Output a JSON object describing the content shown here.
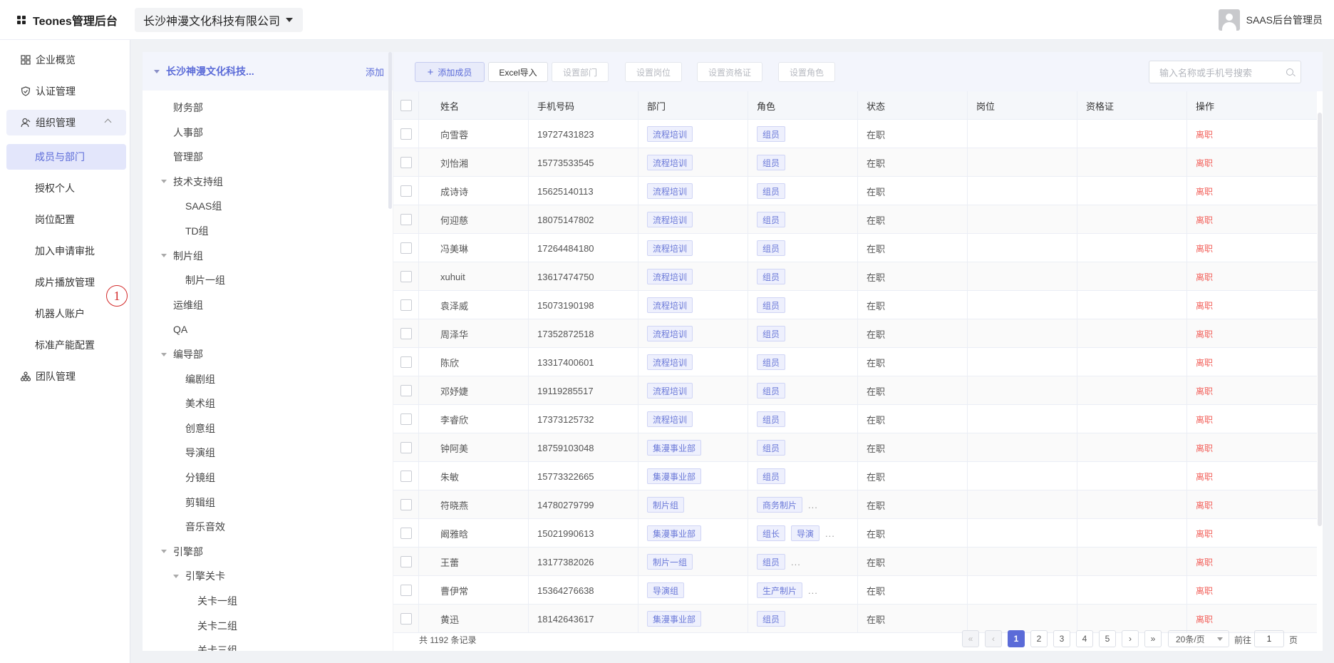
{
  "header": {
    "brand": "Teones管理后台",
    "company": "长沙神漫文化科技有限公司",
    "user": "SAAS后台管理员"
  },
  "sidebar": {
    "items": [
      {
        "label": "企业概览",
        "icon": "grid-icon"
      },
      {
        "label": "认证管理",
        "icon": "shield-icon"
      },
      {
        "label": "组织管理",
        "icon": "user-icon"
      },
      {
        "label": "成员与部门"
      },
      {
        "label": "授权个人"
      },
      {
        "label": "岗位配置"
      },
      {
        "label": "加入申请审批"
      },
      {
        "label": "成片播放管理"
      },
      {
        "label": "机器人账户"
      },
      {
        "label": "标准产能配置"
      },
      {
        "label": "团队管理",
        "icon": "org-chart-icon"
      }
    ],
    "annotation": "1"
  },
  "tree": {
    "root": "长沙神漫文化科技...",
    "add": "添加",
    "nodes": [
      {
        "label": "财务部",
        "level": 1,
        "arrow": false
      },
      {
        "label": "人事部",
        "level": 1,
        "arrow": false
      },
      {
        "label": "管理部",
        "level": 1,
        "arrow": false
      },
      {
        "label": "技术支持组",
        "level": 1,
        "arrow": true
      },
      {
        "label": "SAAS组",
        "level": 2,
        "arrow": false
      },
      {
        "label": "TD组",
        "level": 2,
        "arrow": false
      },
      {
        "label": "制片组",
        "level": 1,
        "arrow": true
      },
      {
        "label": "制片一组",
        "level": 2,
        "arrow": false
      },
      {
        "label": "运维组",
        "level": 1,
        "arrow": false
      },
      {
        "label": "QA",
        "level": 1,
        "arrow": false
      },
      {
        "label": "编导部",
        "level": 1,
        "arrow": true
      },
      {
        "label": "编剧组",
        "level": 2,
        "arrow": false
      },
      {
        "label": "美术组",
        "level": 2,
        "arrow": false
      },
      {
        "label": "创意组",
        "level": 2,
        "arrow": false
      },
      {
        "label": "导演组",
        "level": 2,
        "arrow": false
      },
      {
        "label": "分镜组",
        "level": 2,
        "arrow": false
      },
      {
        "label": "剪辑组",
        "level": 2,
        "arrow": false
      },
      {
        "label": "音乐音效",
        "level": 2,
        "arrow": false
      },
      {
        "label": "引擎部",
        "level": 1,
        "arrow": true
      },
      {
        "label": "引擎关卡",
        "level": 2,
        "arrow": true
      },
      {
        "label": "关卡一组",
        "level": 3,
        "arrow": false
      },
      {
        "label": "关卡二组",
        "level": 3,
        "arrow": false
      },
      {
        "label": "关卡三组",
        "level": 3,
        "arrow": false
      }
    ]
  },
  "toolbar": {
    "add_member": "添加成员",
    "excel_import": "Excel导入",
    "set_dept": "设置部门",
    "set_post": "设置岗位",
    "set_cert": "设置资格证",
    "set_role": "设置角色",
    "search_placeholder": "输入名称或手机号搜索"
  },
  "table": {
    "headers": [
      "姓名",
      "手机号码",
      "部门",
      "角色",
      "状态",
      "岗位",
      "资格证",
      "操作"
    ],
    "rows": [
      {
        "name": "向雪蓉",
        "phone": "19727431823",
        "dept": "流程培训",
        "roles": [
          "组员"
        ],
        "more": false,
        "status": "在职",
        "op": "离职"
      },
      {
        "name": "刘怡湘",
        "phone": "15773533545",
        "dept": "流程培训",
        "roles": [
          "组员"
        ],
        "more": false,
        "status": "在职",
        "op": "离职"
      },
      {
        "name": "成诗诗",
        "phone": "15625140113",
        "dept": "流程培训",
        "roles": [
          "组员"
        ],
        "more": false,
        "status": "在职",
        "op": "离职"
      },
      {
        "name": "何迎慈",
        "phone": "18075147802",
        "dept": "流程培训",
        "roles": [
          "组员"
        ],
        "more": false,
        "status": "在职",
        "op": "离职"
      },
      {
        "name": "冯美琳",
        "phone": "17264484180",
        "dept": "流程培训",
        "roles": [
          "组员"
        ],
        "more": false,
        "status": "在职",
        "op": "离职"
      },
      {
        "name": "xuhuit",
        "phone": "13617474750",
        "dept": "流程培训",
        "roles": [
          "组员"
        ],
        "more": false,
        "status": "在职",
        "op": "离职"
      },
      {
        "name": "袁泽威",
        "phone": "15073190198",
        "dept": "流程培训",
        "roles": [
          "组员"
        ],
        "more": false,
        "status": "在职",
        "op": "离职"
      },
      {
        "name": "周泽华",
        "phone": "17352872518",
        "dept": "流程培训",
        "roles": [
          "组员"
        ],
        "more": false,
        "status": "在职",
        "op": "离职"
      },
      {
        "name": "陈欣",
        "phone": "13317400601",
        "dept": "流程培训",
        "roles": [
          "组员"
        ],
        "more": false,
        "status": "在职",
        "op": "离职"
      },
      {
        "name": "邓妤婕",
        "phone": "19119285517",
        "dept": "流程培训",
        "roles": [
          "组员"
        ],
        "more": false,
        "status": "在职",
        "op": "离职"
      },
      {
        "name": "李睿欣",
        "phone": "17373125732",
        "dept": "流程培训",
        "roles": [
          "组员"
        ],
        "more": false,
        "status": "在职",
        "op": "离职"
      },
      {
        "name": "钟阿美",
        "phone": "18759103048",
        "dept": "集漫事业部",
        "roles": [
          "组员"
        ],
        "more": false,
        "status": "在职",
        "op": "离职"
      },
      {
        "name": "朱敏",
        "phone": "15773322665",
        "dept": "集漫事业部",
        "roles": [
          "组员"
        ],
        "more": false,
        "status": "在职",
        "op": "离职"
      },
      {
        "name": "符晓燕",
        "phone": "14780279799",
        "dept": "制片组",
        "roles": [
          "商务制片"
        ],
        "more": true,
        "status": "在职",
        "op": "离职"
      },
      {
        "name": "阚雅晗",
        "phone": "15021990613",
        "dept": "集漫事业部",
        "roles": [
          "组长",
          "导演"
        ],
        "more": true,
        "status": "在职",
        "op": "离职"
      },
      {
        "name": "王蕾",
        "phone": "13177382026",
        "dept": "制片一组",
        "roles": [
          "组员"
        ],
        "more": true,
        "status": "在职",
        "op": "离职"
      },
      {
        "name": "曹伊常",
        "phone": "15364276638",
        "dept": "导演组",
        "roles": [
          "生产制片"
        ],
        "more": true,
        "status": "在职",
        "op": "离职"
      },
      {
        "name": "黄迅",
        "phone": "18142643617",
        "dept": "集漫事业部",
        "roles": [
          "组员"
        ],
        "more": false,
        "status": "在职",
        "op": "离职"
      }
    ]
  },
  "pagination": {
    "total": "共 1192 条记录",
    "pages": [
      "1",
      "2",
      "3",
      "4",
      "5"
    ],
    "current": "1",
    "size": "20条/页",
    "goto_label": "前往",
    "goto_value": "1",
    "goto_unit": "页"
  },
  "colors": {
    "accent": "#5b6bd8",
    "danger": "#f2605a"
  }
}
